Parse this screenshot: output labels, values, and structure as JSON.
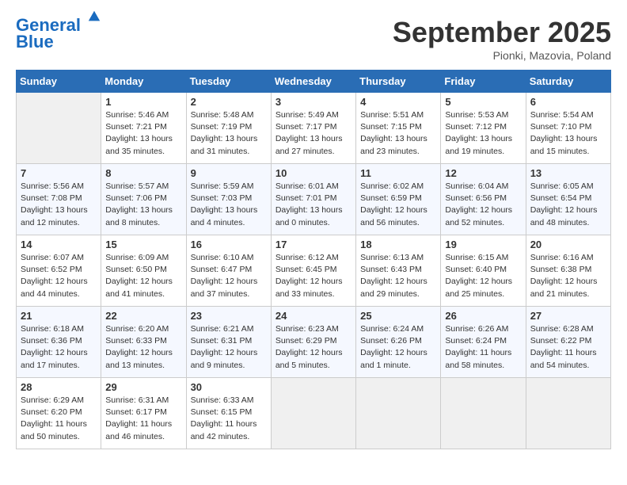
{
  "header": {
    "logo_line1": "General",
    "logo_line2": "Blue",
    "month": "September 2025",
    "location": "Pionki, Mazovia, Poland"
  },
  "weekdays": [
    "Sunday",
    "Monday",
    "Tuesday",
    "Wednesday",
    "Thursday",
    "Friday",
    "Saturday"
  ],
  "weeks": [
    [
      {
        "day": "",
        "info": ""
      },
      {
        "day": "1",
        "info": "Sunrise: 5:46 AM\nSunset: 7:21 PM\nDaylight: 13 hours\nand 35 minutes."
      },
      {
        "day": "2",
        "info": "Sunrise: 5:48 AM\nSunset: 7:19 PM\nDaylight: 13 hours\nand 31 minutes."
      },
      {
        "day": "3",
        "info": "Sunrise: 5:49 AM\nSunset: 7:17 PM\nDaylight: 13 hours\nand 27 minutes."
      },
      {
        "day": "4",
        "info": "Sunrise: 5:51 AM\nSunset: 7:15 PM\nDaylight: 13 hours\nand 23 minutes."
      },
      {
        "day": "5",
        "info": "Sunrise: 5:53 AM\nSunset: 7:12 PM\nDaylight: 13 hours\nand 19 minutes."
      },
      {
        "day": "6",
        "info": "Sunrise: 5:54 AM\nSunset: 7:10 PM\nDaylight: 13 hours\nand 15 minutes."
      }
    ],
    [
      {
        "day": "7",
        "info": "Sunrise: 5:56 AM\nSunset: 7:08 PM\nDaylight: 13 hours\nand 12 minutes."
      },
      {
        "day": "8",
        "info": "Sunrise: 5:57 AM\nSunset: 7:06 PM\nDaylight: 13 hours\nand 8 minutes."
      },
      {
        "day": "9",
        "info": "Sunrise: 5:59 AM\nSunset: 7:03 PM\nDaylight: 13 hours\nand 4 minutes."
      },
      {
        "day": "10",
        "info": "Sunrise: 6:01 AM\nSunset: 7:01 PM\nDaylight: 13 hours\nand 0 minutes."
      },
      {
        "day": "11",
        "info": "Sunrise: 6:02 AM\nSunset: 6:59 PM\nDaylight: 12 hours\nand 56 minutes."
      },
      {
        "day": "12",
        "info": "Sunrise: 6:04 AM\nSunset: 6:56 PM\nDaylight: 12 hours\nand 52 minutes."
      },
      {
        "day": "13",
        "info": "Sunrise: 6:05 AM\nSunset: 6:54 PM\nDaylight: 12 hours\nand 48 minutes."
      }
    ],
    [
      {
        "day": "14",
        "info": "Sunrise: 6:07 AM\nSunset: 6:52 PM\nDaylight: 12 hours\nand 44 minutes."
      },
      {
        "day": "15",
        "info": "Sunrise: 6:09 AM\nSunset: 6:50 PM\nDaylight: 12 hours\nand 41 minutes."
      },
      {
        "day": "16",
        "info": "Sunrise: 6:10 AM\nSunset: 6:47 PM\nDaylight: 12 hours\nand 37 minutes."
      },
      {
        "day": "17",
        "info": "Sunrise: 6:12 AM\nSunset: 6:45 PM\nDaylight: 12 hours\nand 33 minutes."
      },
      {
        "day": "18",
        "info": "Sunrise: 6:13 AM\nSunset: 6:43 PM\nDaylight: 12 hours\nand 29 minutes."
      },
      {
        "day": "19",
        "info": "Sunrise: 6:15 AM\nSunset: 6:40 PM\nDaylight: 12 hours\nand 25 minutes."
      },
      {
        "day": "20",
        "info": "Sunrise: 6:16 AM\nSunset: 6:38 PM\nDaylight: 12 hours\nand 21 minutes."
      }
    ],
    [
      {
        "day": "21",
        "info": "Sunrise: 6:18 AM\nSunset: 6:36 PM\nDaylight: 12 hours\nand 17 minutes."
      },
      {
        "day": "22",
        "info": "Sunrise: 6:20 AM\nSunset: 6:33 PM\nDaylight: 12 hours\nand 13 minutes."
      },
      {
        "day": "23",
        "info": "Sunrise: 6:21 AM\nSunset: 6:31 PM\nDaylight: 12 hours\nand 9 minutes."
      },
      {
        "day": "24",
        "info": "Sunrise: 6:23 AM\nSunset: 6:29 PM\nDaylight: 12 hours\nand 5 minutes."
      },
      {
        "day": "25",
        "info": "Sunrise: 6:24 AM\nSunset: 6:26 PM\nDaylight: 12 hours\nand 1 minute."
      },
      {
        "day": "26",
        "info": "Sunrise: 6:26 AM\nSunset: 6:24 PM\nDaylight: 11 hours\nand 58 minutes."
      },
      {
        "day": "27",
        "info": "Sunrise: 6:28 AM\nSunset: 6:22 PM\nDaylight: 11 hours\nand 54 minutes."
      }
    ],
    [
      {
        "day": "28",
        "info": "Sunrise: 6:29 AM\nSunset: 6:20 PM\nDaylight: 11 hours\nand 50 minutes."
      },
      {
        "day": "29",
        "info": "Sunrise: 6:31 AM\nSunset: 6:17 PM\nDaylight: 11 hours\nand 46 minutes."
      },
      {
        "day": "30",
        "info": "Sunrise: 6:33 AM\nSunset: 6:15 PM\nDaylight: 11 hours\nand 42 minutes."
      },
      {
        "day": "",
        "info": ""
      },
      {
        "day": "",
        "info": ""
      },
      {
        "day": "",
        "info": ""
      },
      {
        "day": "",
        "info": ""
      }
    ]
  ]
}
